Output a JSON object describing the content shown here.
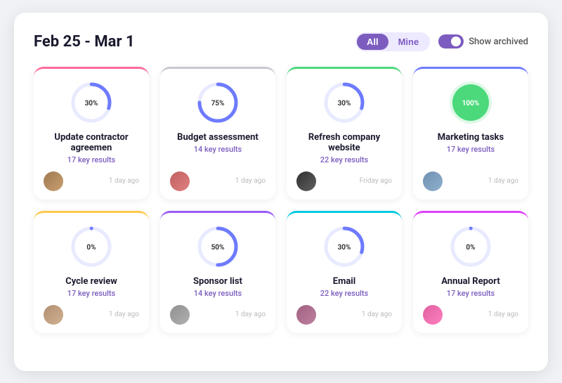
{
  "header": {
    "title": "Feb 25 - Mar 1",
    "filter": {
      "options": [
        "All",
        "Mine"
      ],
      "active": "All"
    },
    "toggle_label": "Show archived"
  },
  "cards": [
    {
      "id": "card-1",
      "title": "Update contractor agreemen",
      "subtitle": "17 key results",
      "percent": 30,
      "time": "1 day ago",
      "border_class": "border-pink",
      "stroke_color": "#6e7bff",
      "stroke_bg": "#e8eaff",
      "full": false,
      "avatar_class": "av1"
    },
    {
      "id": "card-2",
      "title": "Budget assessment",
      "subtitle": "14 key results",
      "percent": 75,
      "time": "1 day ago",
      "border_class": "border-gray",
      "stroke_color": "#6e7bff",
      "stroke_bg": "#e8eaff",
      "full": false,
      "avatar_class": "av2"
    },
    {
      "id": "card-3",
      "title": "Refresh company website",
      "subtitle": "22 key results",
      "percent": 30,
      "time": "Friday ago",
      "border_class": "border-green",
      "stroke_color": "#6e7bff",
      "stroke_bg": "#e8eaff",
      "full": false,
      "avatar_class": "av3"
    },
    {
      "id": "card-4",
      "title": "Marketing tasks",
      "subtitle": "17 key results",
      "percent": 100,
      "time": "1 day ago",
      "border_class": "border-indigo",
      "stroke_color": "#4cd97b",
      "stroke_bg": "#d0f5e0",
      "full": true,
      "avatar_class": "av4"
    },
    {
      "id": "card-5",
      "title": "Cycle review",
      "subtitle": "17 key results",
      "percent": 0,
      "time": "1 day ago",
      "border_class": "border-yellow",
      "stroke_color": "#6e7bff",
      "stroke_bg": "#e8eaff",
      "full": false,
      "avatar_class": "av5"
    },
    {
      "id": "card-6",
      "title": "Sponsor list",
      "subtitle": "14 key results",
      "percent": 50,
      "time": "1 day ago",
      "border_class": "border-purple",
      "stroke_color": "#6e7bff",
      "stroke_bg": "#e8eaff",
      "full": false,
      "avatar_class": "av6"
    },
    {
      "id": "card-7",
      "title": "Email",
      "subtitle": "22 key results",
      "percent": 30,
      "time": "1 day ago",
      "border_class": "border-cyan",
      "stroke_color": "#6e7bff",
      "stroke_bg": "#e8eaff",
      "full": false,
      "avatar_class": "av7"
    },
    {
      "id": "card-8",
      "title": "Annual Report",
      "subtitle": "17 key results",
      "percent": 0,
      "time": "1 day ago",
      "border_class": "border-magenta",
      "stroke_color": "#6e7bff",
      "stroke_bg": "#e8eaff",
      "full": false,
      "avatar_class": "av8"
    }
  ]
}
